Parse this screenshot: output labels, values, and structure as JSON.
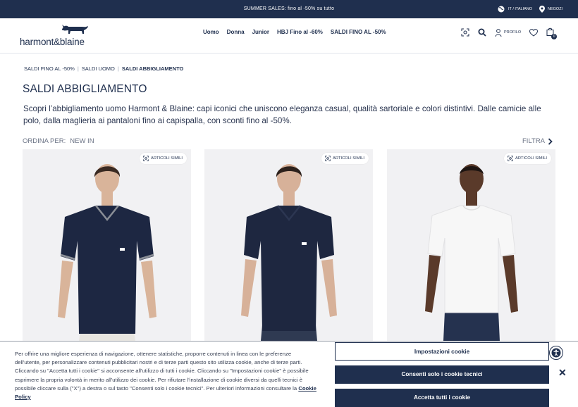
{
  "topbar": {
    "promo": "SUMMER SALES: fino al -50% su tutto",
    "language": "IT / ITALIANO",
    "stores": "NEGOZI"
  },
  "header": {
    "logo_text": "harmont&blaine",
    "nav": [
      "Uomo",
      "Donna",
      "Junior",
      "HBJ Fino al -60%",
      "SALDI FINO AL -50%"
    ],
    "profile_label": "PROFILO",
    "cart_count": "0"
  },
  "breadcrumb": [
    "SALDI FINO AL -50%",
    "SALDI UOMO",
    "SALDI ABBIGLIAMENTO"
  ],
  "page_title": "SALDI ABBIGLIAMENTO",
  "intro": "Scopri l’abbigliamento uomo Harmont & Blaine: capi iconici che uniscono eleganza casual, qualità sartoriale e colori distintivi. Dalle camicie alle polo, dalla maglieria ai pantaloni fino ai capispalla, con sconti fino al -50%.",
  "sort": {
    "label": "ORDINA PER:",
    "value": "NEW IN"
  },
  "filter_label": "FILTRA",
  "products": [
    {
      "badge": "ARTICOLI SIMILI",
      "shirt_color": "#1d2742",
      "accent": "#8a8e96"
    },
    {
      "badge": "ARTICOLI SIMILI",
      "shirt_color": "#1e2740",
      "accent": "#1e2740"
    },
    {
      "badge": "ARTICOLI SIMILI",
      "shirt_color": "#f7f7f7",
      "accent": "#f7f7f7"
    }
  ],
  "cookie": {
    "text": "Per offrire una migliore esperienza di navigazione, ottenere statistiche, proporre contenuti in linea con le preferenze dell'utente, per personalizzare contenuti pubblicitari nostri e di terze parti questo sito utilizza cookie, anche di terze parti. Cliccando su \"Accetta tutti i cookie\" si acconsente all'utilizzo di tutti i cookie. Cliccando su \"Impostazioni cookie\" è possibile esprimere la propria volontà in merito all'utilizzo dei cookie. Per rifiutare l'installazione di cookie diversi da quelli tecnici è possibile cliccare sulla (\"X\") a destra o sul tasto \"Consenti solo i cookie tecnici\". Per ulteriori informazioni consultare la",
    "policy_link": "Cookie Policy",
    "settings_button": "Impostazioni cookie",
    "technical_button": "Consenti solo i cookie tecnici",
    "accept_button": "Accetta tutti i cookie"
  }
}
